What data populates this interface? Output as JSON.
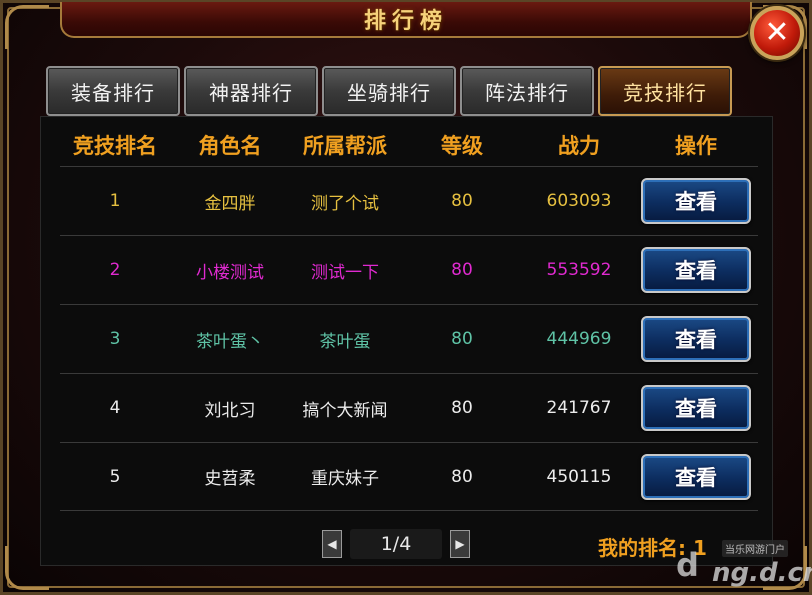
{
  "window": {
    "title": "排行榜",
    "close_icon": "close-x-icon"
  },
  "tabs": [
    {
      "label": "装备排行",
      "active": false
    },
    {
      "label": "神器排行",
      "active": false
    },
    {
      "label": "坐骑排行",
      "active": false
    },
    {
      "label": "阵法排行",
      "active": false
    },
    {
      "label": "竞技排行",
      "active": true
    }
  ],
  "table": {
    "headers": [
      "竞技排名",
      "角色名",
      "所属帮派",
      "等级",
      "战力",
      "操作"
    ],
    "rows": [
      {
        "rank": "1",
        "name": "金四胖",
        "guild": "测了个试",
        "level": "80",
        "power": "603093",
        "action": "查看",
        "color": "#e6c040"
      },
      {
        "rank": "2",
        "name": "小楼测试",
        "guild": "测试一下",
        "level": "80",
        "power": "553592",
        "action": "查看",
        "color": "#e02ad0"
      },
      {
        "rank": "3",
        "name": "茶叶蛋丶",
        "guild": "茶叶蛋",
        "level": "80",
        "power": "444969",
        "action": "查看",
        "color": "#5fc3a6"
      },
      {
        "rank": "4",
        "name": "刘北习",
        "guild": "搞个大新闻",
        "level": "80",
        "power": "241767",
        "action": "查看",
        "color": "#ececec"
      },
      {
        "rank": "5",
        "name": "史苕柔",
        "guild": "重庆妹子",
        "level": "80",
        "power": "450115",
        "action": "查看",
        "color": "#ececec"
      }
    ]
  },
  "pager": {
    "prev_icon": "triangle-left-icon",
    "next_icon": "triangle-right-icon",
    "current": "1/4"
  },
  "my_rank": "我的排名: 1",
  "watermark": {
    "top_text": "当乐网游门户",
    "logo_text": "d",
    "main_text": "ng.d.cn"
  },
  "colors": {
    "header": "#f0a020",
    "title": "#f6d27a",
    "tab_active_border": "#c79a52",
    "button_blue": "#1b4a86"
  }
}
